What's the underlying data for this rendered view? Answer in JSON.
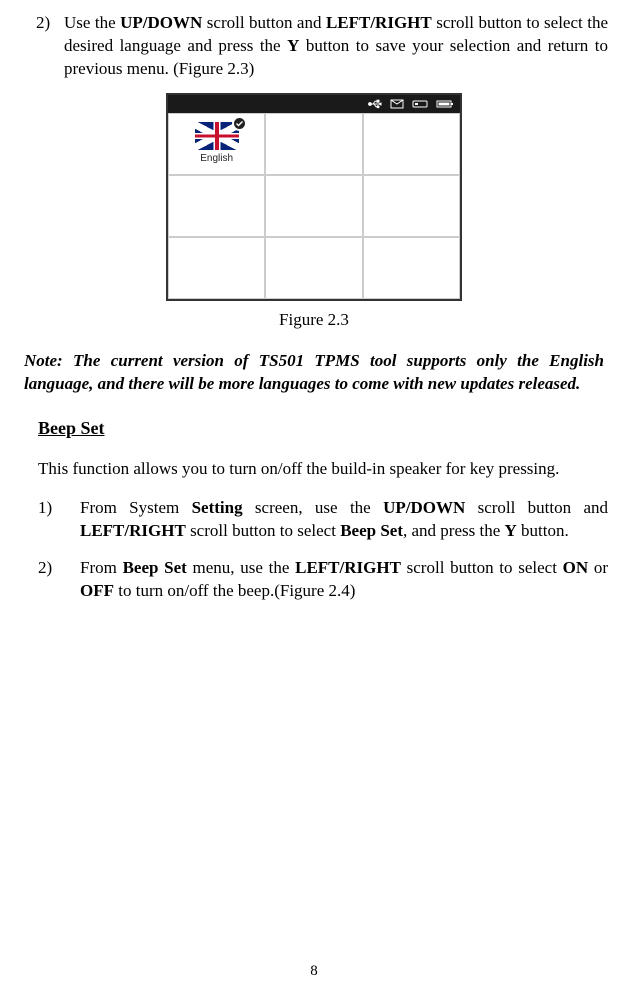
{
  "step2": {
    "num": "2)",
    "t1": "Use the ",
    "b1": "UP/DOWN",
    "t2": " scroll button and ",
    "b2": "LEFT/RIGHT",
    "t3": " scroll button to select the desired language and press the ",
    "b3": "Y",
    "t4": " button to save your selection and return to previous menu. (Figure 2.3)"
  },
  "device": {
    "flag_label": "English"
  },
  "fig_caption": "Figure 2.3",
  "note": "Note: The current version of TS501 TPMS tool supports only the English language, and there will be more languages to come with new updates released.",
  "section_h": "Beep Set",
  "section_p": "This function allows you to turn on/off the build-in speaker for key pressing.",
  "beep1": {
    "num": "1)",
    "t1": "From System ",
    "b1": "Setting",
    "t2": " screen, use the ",
    "b2": "UP/DOWN",
    "t3": " scroll button and ",
    "b3": "LEFT/RIGHT",
    "t4": " scroll button to select ",
    "b4": "Beep Set",
    "t5": ", and press the ",
    "b5": "Y",
    "t6": " button."
  },
  "beep2": {
    "num": "2)",
    "t1": "From ",
    "b1": "Beep Set",
    "t2": " menu, use the ",
    "b2": "LEFT/RIGHT",
    "t3": " scroll button to select ",
    "b3": "ON",
    "t4": " or ",
    "b4": "OFF",
    "t5": " to turn on/off the beep.(Figure 2.4)"
  },
  "page_num": "8"
}
